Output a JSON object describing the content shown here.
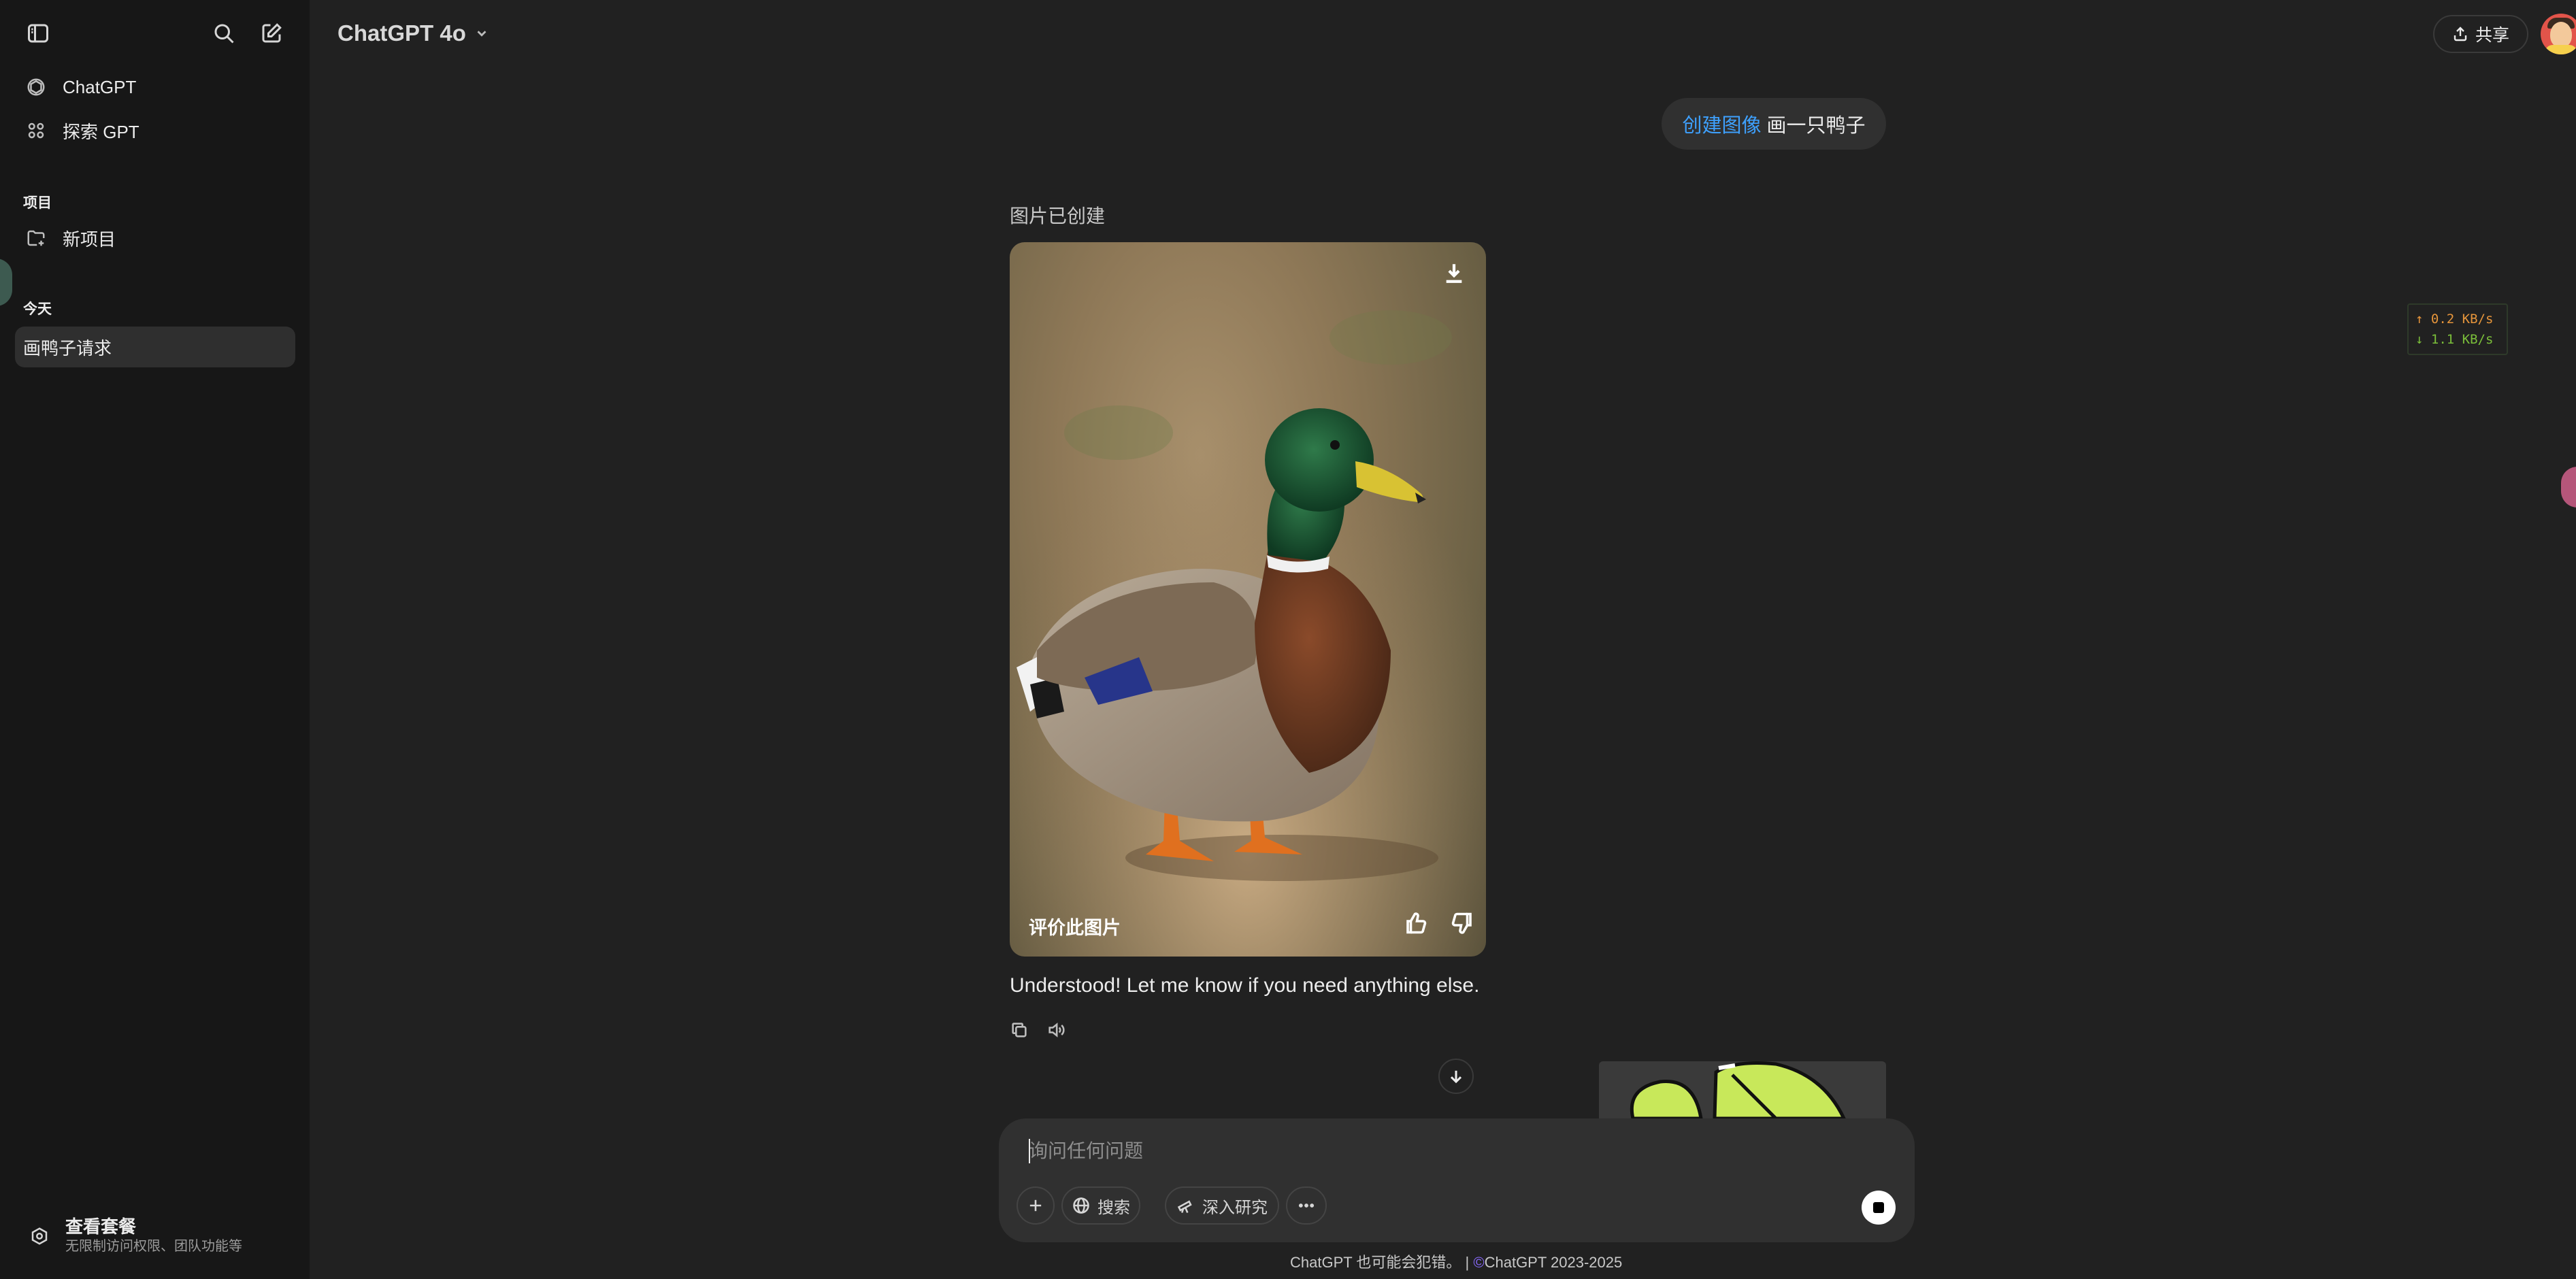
{
  "sidebar": {
    "items": [
      {
        "label": "ChatGPT",
        "icon": "openai-logo-icon"
      },
      {
        "label": "探索 GPT",
        "icon": "grid-icon"
      }
    ],
    "projects_heading": "项目",
    "new_project_label": "新项目",
    "today_heading": "今天",
    "history": [
      {
        "label": "画鸭子请求",
        "active": true
      }
    ],
    "plan": {
      "title": "查看套餐",
      "subtitle": "无限制访问权限、团队功能等"
    }
  },
  "header": {
    "model_name": "ChatGPT 4o",
    "share_label": "共享"
  },
  "speed_widget": {
    "upload": "↑ 0.2 KB/s",
    "download": "↓ 1.1 KB/s"
  },
  "conversation": {
    "user_message": {
      "tool_label": "创建图像",
      "text": "画一只鸭子"
    },
    "image_status": "图片已创建",
    "rate_image_label": "评价此图片",
    "assistant_text": "Understood! Let me know if you need anything else."
  },
  "composer": {
    "placeholder": "询问任何问题",
    "search_label": "搜索",
    "deep_research_label": "深入研究"
  },
  "footer": {
    "disclaimer": "ChatGPT 也可能会犯错。 |",
    "copyright_symbol": "©",
    "copyright": "ChatGPT 2023-2025"
  },
  "colors": {
    "background": "#212121",
    "sidebar": "#171717",
    "accent_link": "#3ea1ff",
    "bubble": "#303030"
  }
}
